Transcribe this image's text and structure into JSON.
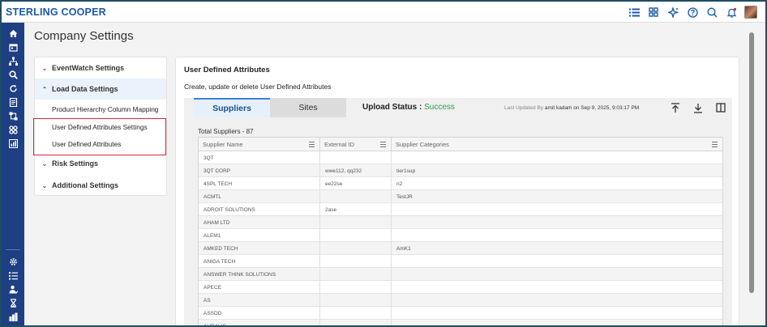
{
  "app": {
    "brand": "STERLING COOPER"
  },
  "header": {
    "icons": [
      "list-icon",
      "grid-icon",
      "sparkle-icon",
      "help-icon",
      "search-icon",
      "bell-icon",
      "avatar"
    ]
  },
  "rail": {
    "icons": [
      "home-icon",
      "calendar-icon",
      "org-icon",
      "search-icon",
      "refresh-icon",
      "document-icon",
      "network-icon",
      "apps-icon",
      "report-icon",
      "settings-icon",
      "checklist-icon",
      "users-icon",
      "hourglass-icon",
      "chart-icon"
    ]
  },
  "page": {
    "title": "Company Settings"
  },
  "nav": {
    "sections": [
      {
        "label": "EventWatch Settings",
        "expanded": false
      },
      {
        "label": "Load Data Settings",
        "expanded": true,
        "items": [
          "Product Hierarchy Column Mapping",
          "User Defined Attributes Settings",
          "User Defined Attributes"
        ]
      },
      {
        "label": "Risk Settings",
        "expanded": false
      },
      {
        "label": "Additional Settings",
        "expanded": false
      }
    ]
  },
  "main": {
    "title": "User Defined Attributes",
    "subtitle": "Create, update or delete User Defined Attributes",
    "tabs": [
      {
        "label": "Suppliers",
        "active": true
      },
      {
        "label": "Sites",
        "active": false
      }
    ],
    "upload_status_label": "Upload Status :",
    "upload_status_value": "Success",
    "last_updated_prefix": "Last Updated By",
    "last_updated_detail": "amit kadam on Sep 9, 2025, 9:03:17 PM",
    "toolbar_icons": [
      "upload-icon",
      "download-icon",
      "columns-icon"
    ],
    "total": "Total Suppliers - 87",
    "columns": [
      "Supplier Name",
      "External ID",
      "Supplier Categories"
    ],
    "rows": [
      [
        "3QT",
        "",
        ""
      ],
      [
        "3QT CORP",
        "wwe112, qq232",
        "tier1sup"
      ],
      [
        "4SPL TECH",
        "ee22se",
        "n2"
      ],
      [
        "ACMTL",
        "",
        "TestJR"
      ],
      [
        "ADROIT SOLUTIONS",
        "2ase",
        ""
      ],
      [
        "AHAM LTD",
        "",
        ""
      ],
      [
        "ALEM1",
        "",
        ""
      ],
      [
        "AMKED TECH",
        "",
        "AmK1"
      ],
      [
        "ANIGA TECH",
        "",
        ""
      ],
      [
        "ANSWER THINK SOLUTIONS",
        "",
        ""
      ],
      [
        "APECE",
        "",
        ""
      ],
      [
        "AS",
        "",
        ""
      ],
      [
        "ASSDD",
        "",
        ""
      ],
      [
        "AURALIS",
        "",
        ""
      ]
    ]
  },
  "colors": {
    "brand": "#1b58a8",
    "rail": "#1f3f84",
    "success": "#2d9a4e",
    "highlight_box": "#d9263a",
    "frame": "#1d4e63"
  }
}
